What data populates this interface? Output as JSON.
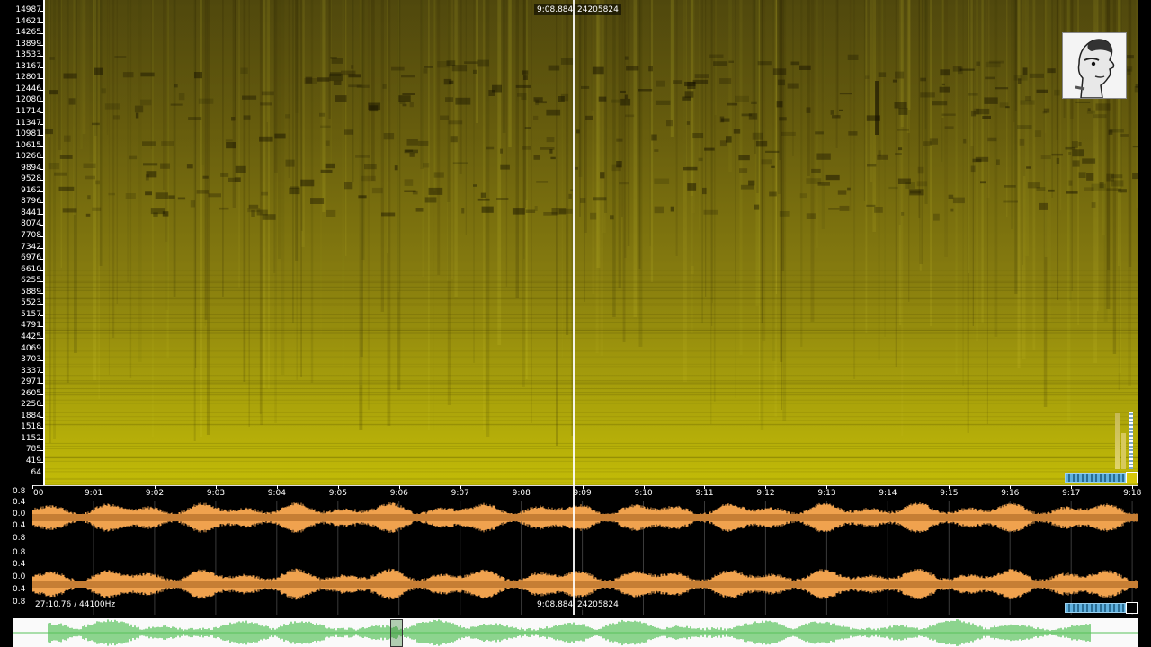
{
  "spectrogram": {
    "frequency_labels": [
      "14987",
      "14621",
      "14265",
      "13899",
      "13533",
      "13167",
      "12801",
      "12446",
      "12080",
      "11714",
      "11347",
      "10981",
      "10615",
      "10260",
      "9894",
      "9528",
      "9162",
      "8796",
      "8441",
      "8074",
      "7708",
      "7342",
      "6976",
      "6610",
      "6255",
      "5889",
      "5523",
      "5157",
      "4791",
      "4425",
      "4069",
      "3703",
      "3337",
      "2971",
      "2605",
      "2250",
      "1884",
      "1518",
      "1152",
      "785",
      "419",
      "64"
    ],
    "colors": {
      "low": "#c2bb07",
      "high": "#6f6412",
      "cursor": "#ffffff"
    }
  },
  "cursor": {
    "time": "9:08.884",
    "sample": "24205824"
  },
  "time_ruler": {
    "labels": [
      "00",
      "9:01",
      "9:02",
      "9:03",
      "9:04",
      "9:05",
      "9:06",
      "9:07",
      "9:08",
      "9:09",
      "9:10",
      "9:11",
      "9:12",
      "9:13",
      "9:14",
      "9:15",
      "9:16",
      "9:17",
      "9:18"
    ]
  },
  "waveform": {
    "amplitude_labels": [
      "0.8",
      "0.4",
      "0.0",
      "0.4",
      "0.8",
      "0.8",
      "0.4",
      "0.0",
      "0.4",
      "0.8"
    ],
    "duration_info": "27:10.76 / 44100Hz",
    "colors": {
      "wave": "#f0a24e",
      "wave_core": "#b8712c"
    }
  },
  "overview": {
    "colors": {
      "wave": "#58c25a"
    }
  },
  "thumbnail": {
    "icon": "face-profile-icon"
  }
}
